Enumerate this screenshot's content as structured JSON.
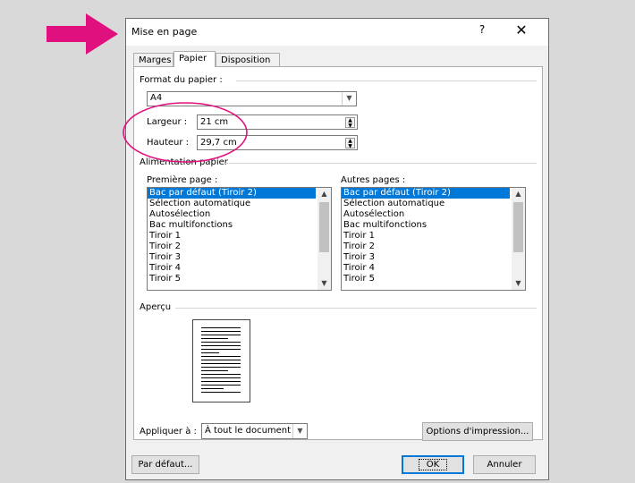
{
  "dialog": {
    "title": "Mise en page",
    "help_label": "?",
    "close_label": "✕"
  },
  "tabs": [
    {
      "label": "Marges",
      "active": false
    },
    {
      "label": "Papier",
      "active": true
    },
    {
      "label": "Disposition",
      "active": false
    }
  ],
  "paper_format": {
    "group_label": "Format du papier :",
    "selected": "A4",
    "width_label": "Largeur :",
    "width_value": "21 cm",
    "height_label": "Hauteur :",
    "height_value": "29,7 cm"
  },
  "paper_source": {
    "group_label": "Alimentation papier",
    "first_page_label": "Première page :",
    "other_pages_label": "Autres pages :",
    "options": [
      "Bac par défaut (Tiroir 2)",
      "Sélection automatique",
      "Autosélection",
      "Bac multifonctions",
      "Tiroir 1",
      "Tiroir 2",
      "Tiroir 3",
      "Tiroir 4",
      "Tiroir 5"
    ],
    "first_page_selected": "Bac par défaut (Tiroir 2)",
    "other_pages_selected": "Bac par défaut (Tiroir 2)"
  },
  "preview": {
    "label": "Aperçu"
  },
  "apply": {
    "label": "Appliquer à :",
    "value": "À tout le document"
  },
  "buttons": {
    "print_options": "Options d'impression...",
    "default": "Par défaut...",
    "ok": "OK",
    "cancel": "Annuler"
  },
  "colors": {
    "annotation": "#e0117f",
    "selection": "#0078d7"
  },
  "icons": {
    "annotation_arrow": "right-arrow-icon",
    "combo_dropdown": "chevron-down-icon",
    "spinner": "spin-updown-icon"
  }
}
